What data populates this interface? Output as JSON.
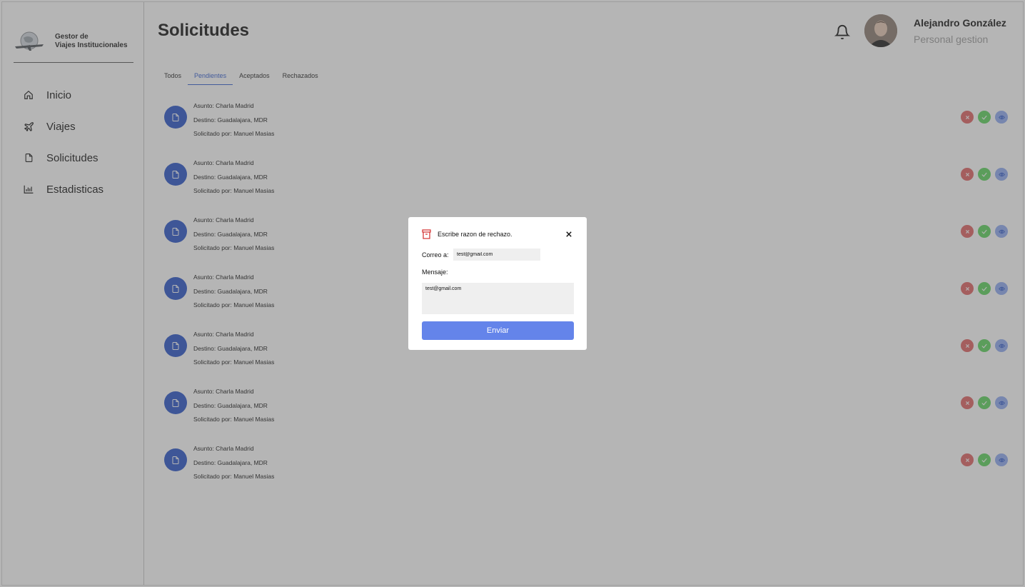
{
  "app": {
    "name_line1": "Gestor de",
    "name_line2": "Viajes Institucionales"
  },
  "sidebar": {
    "items": [
      {
        "label": "Inicio",
        "icon": "home-icon"
      },
      {
        "label": "Viajes",
        "icon": "plane-icon"
      },
      {
        "label": "Solicitudes",
        "icon": "document-icon"
      },
      {
        "label": "Estadisticas",
        "icon": "bar-chart-icon"
      }
    ]
  },
  "header": {
    "title": "Solicitudes",
    "user_name": "Alejandro González",
    "user_role": "Personal gestion"
  },
  "tabs": [
    {
      "label": "Todos",
      "active": false
    },
    {
      "label": "Pendientes",
      "active": true
    },
    {
      "label": "Aceptados",
      "active": false
    },
    {
      "label": "Rechazados",
      "active": false
    }
  ],
  "requests": [
    {
      "asunto": "Asunto: Charla Madrid",
      "destino": "Destino: Guadalajara, MDR",
      "solicitado": "Solicitado por:  Manuel Masias"
    },
    {
      "asunto": "Asunto: Charla Madrid",
      "destino": "Destino: Guadalajara, MDR",
      "solicitado": "Solicitado por:  Manuel Masias"
    },
    {
      "asunto": "Asunto: Charla Madrid",
      "destino": "Destino: Guadalajara, MDR",
      "solicitado": "Solicitado por:  Manuel Masias"
    },
    {
      "asunto": "Asunto: Charla Madrid",
      "destino": "Destino: Guadalajara, MDR",
      "solicitado": "Solicitado por:  Manuel Masias"
    },
    {
      "asunto": "Asunto: Charla Madrid",
      "destino": "Destino: Guadalajara, MDR",
      "solicitado": "Solicitado por:  Manuel Masias"
    },
    {
      "asunto": "Asunto: Charla Madrid",
      "destino": "Destino: Guadalajara, MDR",
      "solicitado": "Solicitado por:  Manuel Masias"
    },
    {
      "asunto": "Asunto: Charla Madrid",
      "destino": "Destino: Guadalajara, MDR",
      "solicitado": "Solicitado por:  Manuel Masias"
    }
  ],
  "modal": {
    "title": "Escribe razon de rechazo.",
    "to_label": "Correo a:",
    "to_value": "test@gmail.com",
    "message_label": "Mensaje:",
    "message_value": "test@gmail.com",
    "send_label": "Enviar"
  },
  "colors": {
    "primary": "#2753c8",
    "reject": "#e06262",
    "accept": "#5bd35b",
    "view": "#8ea9f2",
    "send": "#6484ea"
  }
}
